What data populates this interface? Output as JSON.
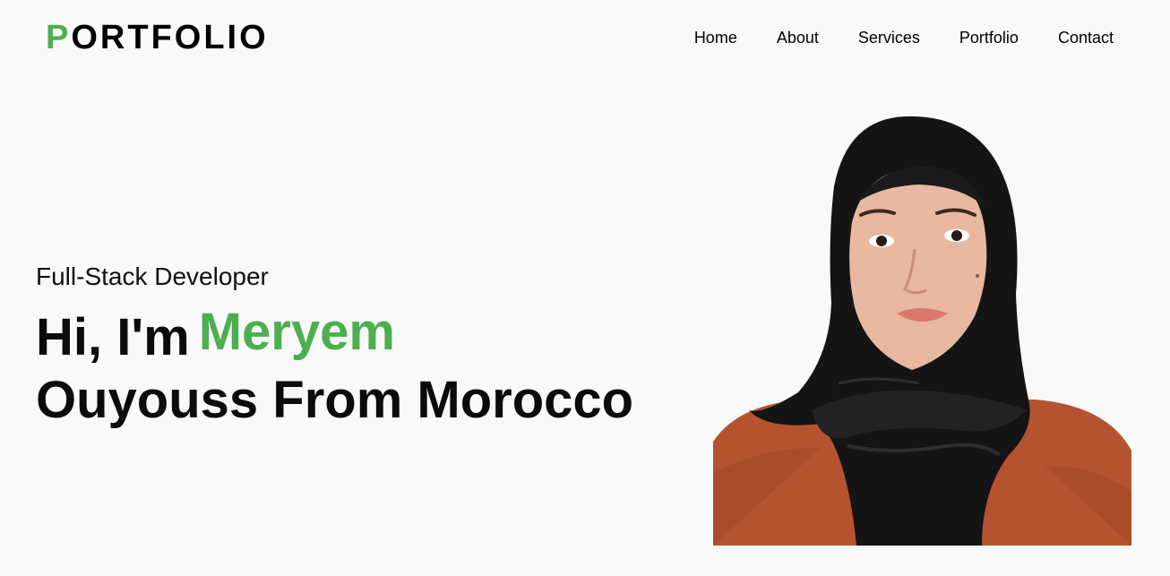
{
  "header": {
    "logo_first": "P",
    "logo_rest": "ORTFOLIO",
    "nav": [
      {
        "label": "Home"
      },
      {
        "label": "About"
      },
      {
        "label": "Services"
      },
      {
        "label": "Portfolio"
      },
      {
        "label": "Contact"
      }
    ]
  },
  "hero": {
    "subtitle": "Full-Stack Developer",
    "greeting": "Hi, I'm",
    "first_name": "Meryem",
    "rest": "Ouyouss From Morocco"
  },
  "colors": {
    "accent": "#4caf50",
    "background": "#f9f9fa",
    "text": "#000000"
  }
}
